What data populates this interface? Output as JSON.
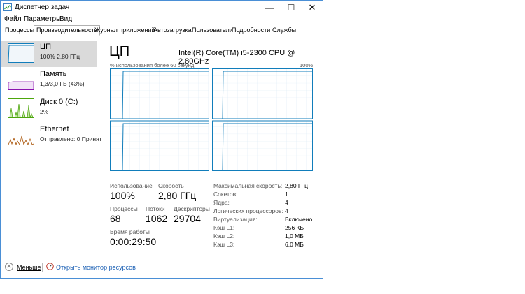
{
  "window": {
    "title": "Диспетчер задач",
    "controls": {
      "minimize": "—",
      "maximize": "☐",
      "close": "✕"
    },
    "icon": "task-manager-icon"
  },
  "menu": [
    "Файл",
    "Параметры",
    "Вид"
  ],
  "tabs": [
    {
      "label": "Процессы",
      "active": false
    },
    {
      "label": "Производительность",
      "active": true
    },
    {
      "label": "Журнал приложений",
      "active": false
    },
    {
      "label": "Автозагрузка",
      "active": false
    },
    {
      "label": "Пользователи",
      "active": false
    },
    {
      "label": "Подробности",
      "active": false
    },
    {
      "label": "Службы",
      "active": false
    }
  ],
  "sidebar": [
    {
      "title": "ЦП",
      "subtitle": "100% 2,80 ГГц",
      "selected": true,
      "color": "#117dbb"
    },
    {
      "title": "Память",
      "subtitle": "1,3/3,0 ГБ (43%)",
      "selected": false,
      "color": "#8b12ae"
    },
    {
      "title": "Диск 0 (C:)",
      "subtitle": "2%",
      "selected": false,
      "color": "#4da60c"
    },
    {
      "title": "Ethernet",
      "subtitle": "Отправлено: 0 Принят",
      "selected": false,
      "color": "#a74f01"
    }
  ],
  "cpu": {
    "title": "ЦП",
    "model": "Intel(R) Core(TM) i5-2300 CPU @ 2.80GHz",
    "graph_label": "% использования более 60 секунд",
    "graph_max": "100%",
    "graph_color": "#117dbb",
    "usage_label": "Использование",
    "usage": "100%",
    "speed_label": "Скорость",
    "speed": "2,80 ГГц",
    "processes_label": "Процессы",
    "processes": "68",
    "threads_label": "Потоки",
    "threads": "1062",
    "handles_label": "Дескрипторы",
    "handles": "29704",
    "uptime_label": "Время работы",
    "uptime": "0:00:29:50",
    "details": [
      {
        "label": "Максимальная скорость:",
        "value": "2,80 ГГц"
      },
      {
        "label": "Сокетов:",
        "value": "1"
      },
      {
        "label": "Ядра:",
        "value": "4"
      },
      {
        "label": "Логических процессоров:",
        "value": "4"
      },
      {
        "label": "Виртуализация:",
        "value": "Включено"
      },
      {
        "label": "Кэш L1:",
        "value": "256 КБ"
      },
      {
        "label": "Кэш L2:",
        "value": "1,0 МБ"
      },
      {
        "label": "Кэш L3:",
        "value": "6,0 МБ"
      }
    ]
  },
  "footer": {
    "fewer_label": "Меньше",
    "monitor_label": "Открыть монитор ресурсов"
  }
}
